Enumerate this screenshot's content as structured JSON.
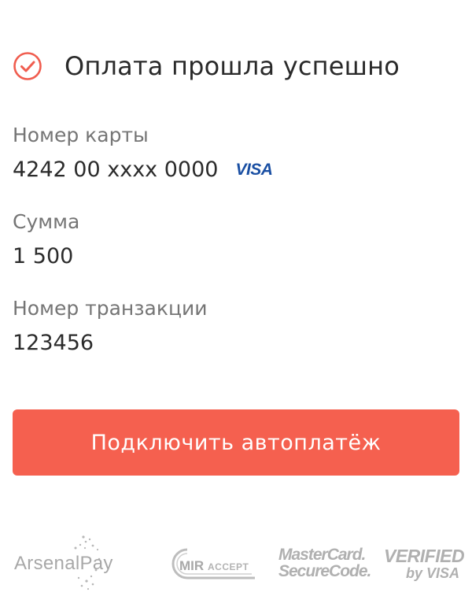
{
  "status": {
    "title": "Оплата прошла успешно",
    "icon": "check-circle-icon",
    "icon_color": "#f05d4f"
  },
  "fields": {
    "card": {
      "label": "Номер карты",
      "value": "4242 00 xxxx 0000",
      "brand": "VISA"
    },
    "amount": {
      "label": "Сумма",
      "value": "1 500"
    },
    "transaction": {
      "label": "Номер транзакции",
      "value": "123456"
    }
  },
  "button": {
    "label": "Подключить автоплатёж",
    "color": "#f5604f"
  },
  "footer_logos": {
    "arsenal": "ArsenalPay",
    "mir_accept": "MIR ACCEPT",
    "mastercard_line1": "MasterCard.",
    "mastercard_line2": "SecureCode.",
    "verified_line1": "VERIFIED",
    "verified_line2": "by VISA"
  }
}
